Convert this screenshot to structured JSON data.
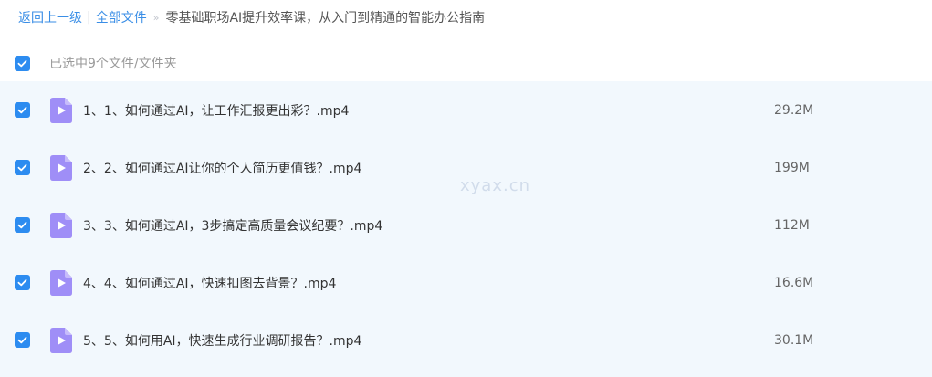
{
  "breadcrumb": {
    "back": "返回上一级",
    "separator": "|",
    "all_files": "全部文件",
    "arrow": "»",
    "current": "零基础职场AI提升效率课，从入门到精通的智能办公指南"
  },
  "selection": {
    "label": "已选中9个文件/文件夹"
  },
  "icons": {
    "checkbox": "checkbox-checked-icon",
    "file": "video-file-icon"
  },
  "colors": {
    "accent": "#2d8cf0",
    "link": "#3a8ee6",
    "file_icon": "#9f8ef7",
    "list_bg": "#f2f8fd"
  },
  "files": [
    {
      "name": "1、1、如何通过AI，让工作汇报更出彩？.mp4",
      "size": "29.2M"
    },
    {
      "name": "2、2、如何通过AI让你的个人简历更值钱？.mp4",
      "size": "199M"
    },
    {
      "name": "3、3、如何通过AI，3步搞定高质量会议纪要？.mp4",
      "size": "112M"
    },
    {
      "name": "4、4、如何通过AI，快速扣图去背景？.mp4",
      "size": "16.6M"
    },
    {
      "name": "5、5、如何用AI，快速生成行业调研报告？.mp4",
      "size": "30.1M"
    }
  ],
  "watermark": "xyax.cn"
}
